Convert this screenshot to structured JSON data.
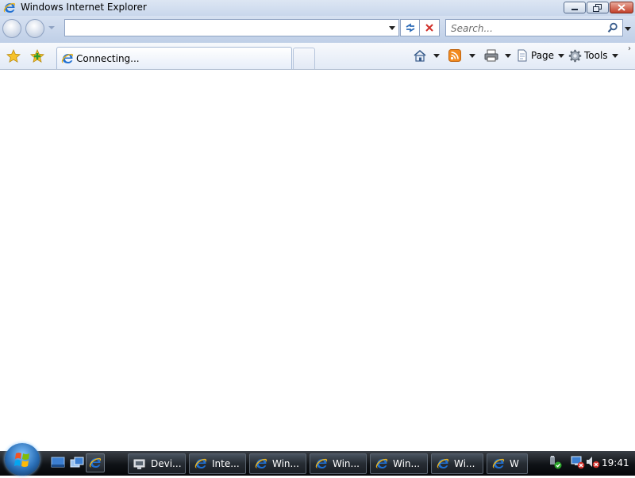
{
  "window": {
    "title": "Windows Internet Explorer"
  },
  "address_bar": {
    "value": ""
  },
  "search": {
    "placeholder": "Search..."
  },
  "tab": {
    "label": "Connecting..."
  },
  "command_bar": {
    "page_label": "Page",
    "tools_label": "Tools"
  },
  "taskbar": {
    "buttons": [
      {
        "label": "Devi...",
        "icon": "device-manager-icon"
      },
      {
        "label": "Inte...",
        "icon": "ie-icon"
      },
      {
        "label": "Win...",
        "icon": "ie-icon"
      },
      {
        "label": "Win...",
        "icon": "ie-icon"
      },
      {
        "label": "Win...",
        "icon": "ie-icon"
      },
      {
        "label": "Wi...",
        "icon": "ie-icon"
      },
      {
        "label": "W",
        "icon": "ie-icon"
      }
    ],
    "clock": "19:41"
  },
  "colors": {
    "accent": "#2a6fb7",
    "ie_blue": "#1f6fd1",
    "ie_gold": "#e8b320"
  }
}
